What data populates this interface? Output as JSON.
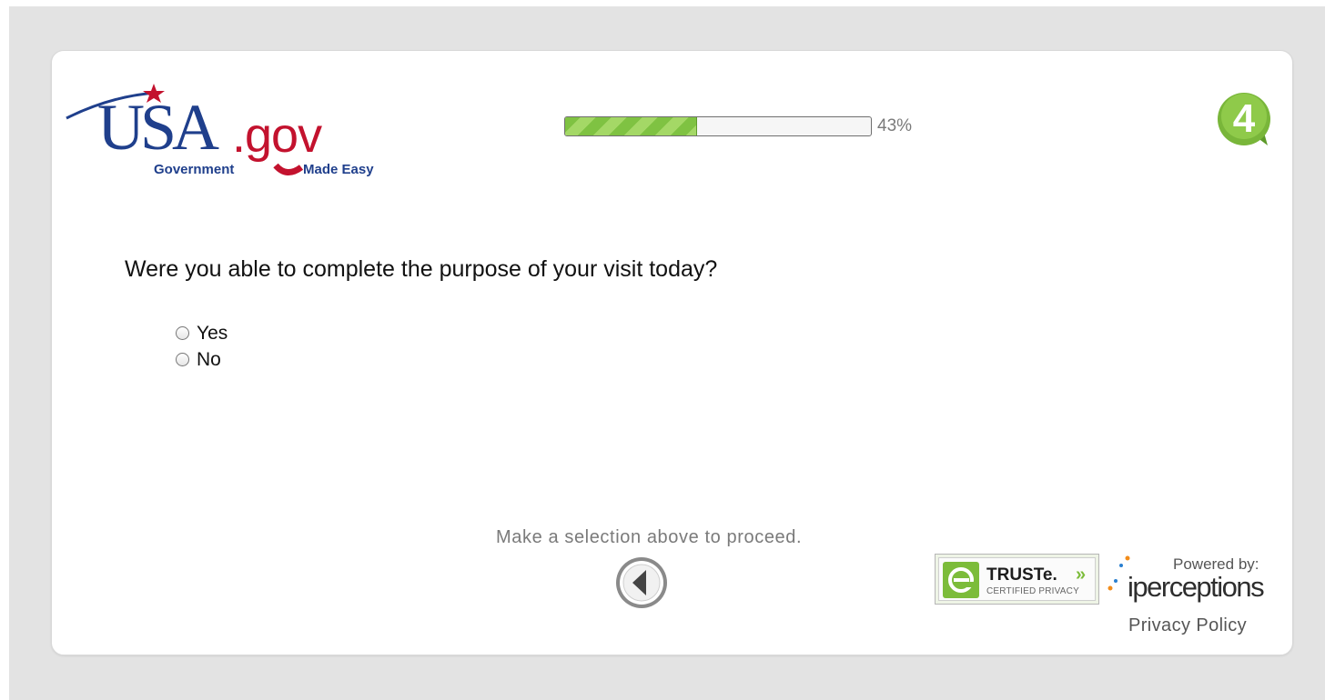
{
  "logo": {
    "main": "USA",
    "domain": ".gov",
    "tag_left": "Government",
    "tag_right": "Made Easy"
  },
  "progress": {
    "percent": 43,
    "label": "43%"
  },
  "badge": {
    "text": "4"
  },
  "question": {
    "text": "Were you able to complete the purpose of your visit today?",
    "options": [
      "Yes",
      "No"
    ],
    "selected": null
  },
  "footer": {
    "hint": "Make a selection above to proceed.",
    "truste_name": "TRUSTe.",
    "truste_chevrons": "»",
    "truste_sub": "CERTIFIED PRIVACY",
    "powered_by": "Powered by:",
    "brand": "iperceptions",
    "privacy_link": "Privacy Policy"
  },
  "colors": {
    "progress_fill": "#7fc242",
    "badge_green": "#79b63a",
    "logo_blue": "#1f3f8c",
    "logo_red": "#c3122e",
    "background": "#e3e3e3"
  },
  "icons": [
    "star-icon",
    "back-arrow-icon",
    "truste-seal-icon",
    "iperceptions-dots-icon",
    "4q-badge-icon"
  ]
}
